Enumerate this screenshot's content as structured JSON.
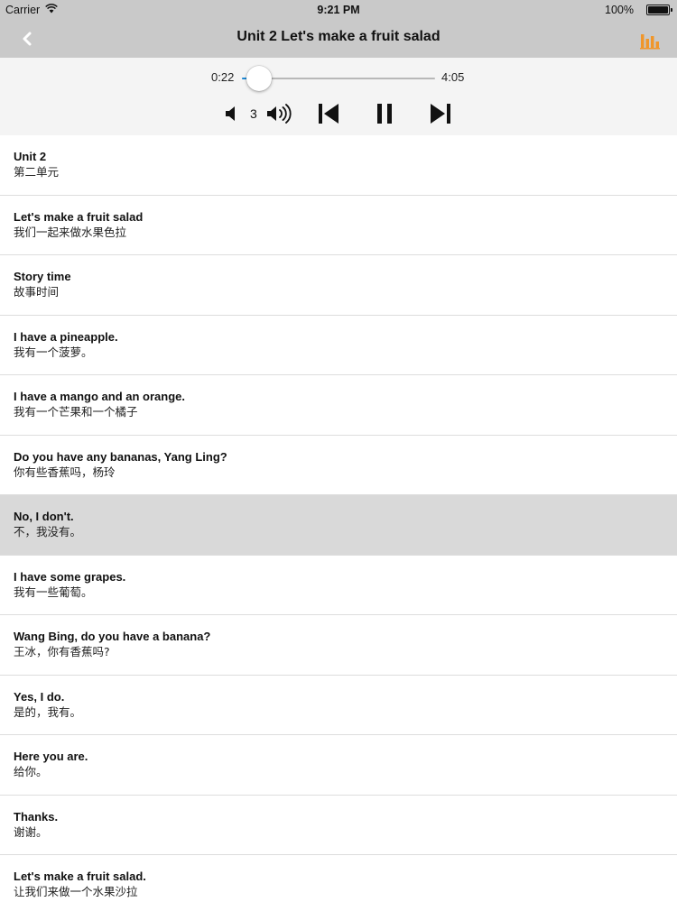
{
  "status_bar": {
    "carrier": "Carrier",
    "time": "9:21 PM",
    "battery": "100%"
  },
  "nav": {
    "title": "Unit 2 Let's make a fruit salad",
    "accent_color": "#f0962a",
    "back_icon": "chevron-left-icon",
    "stats_icon": "bar-chart-icon"
  },
  "player": {
    "elapsed": "0:22",
    "total": "4:05",
    "progress": 0.09,
    "volume": "3",
    "progress_color": "#1e8ad6",
    "icons": [
      "volume-down-icon",
      "volume-up-icon",
      "skip-previous-icon",
      "pause-icon",
      "skip-next-icon"
    ]
  },
  "sentences": [
    {
      "en": "Unit 2",
      "zh": "第二单元"
    },
    {
      "en": "Let's make a fruit salad",
      "zh": "我们一起来做水果色拉"
    },
    {
      "en": "Story time",
      "zh": "故事时间"
    },
    {
      "en": "I have a pineapple.",
      "zh": "我有一个菠萝。"
    },
    {
      "en": "I have a mango and an orange.",
      "zh": "我有一个芒果和一个橘子"
    },
    {
      "en": "Do you have any bananas, Yang Ling?",
      "zh": "你有些香蕉吗，杨玲"
    },
    {
      "en": "No, I don't.",
      "zh": "不，我没有。",
      "selected": true
    },
    {
      "en": "I have some grapes.",
      "zh": "我有一些葡萄。"
    },
    {
      "en": "Wang Bing, do you have a banana?",
      "zh": "王冰，你有香蕉吗?"
    },
    {
      "en": "Yes, I do.",
      "zh": "是的，我有。"
    },
    {
      "en": "Here you are.",
      "zh": "给你。"
    },
    {
      "en": "Thanks.",
      "zh": "谢谢。"
    },
    {
      "en": "Let's make a fruit salad.",
      "zh": "让我们来做一个水果沙拉"
    }
  ]
}
